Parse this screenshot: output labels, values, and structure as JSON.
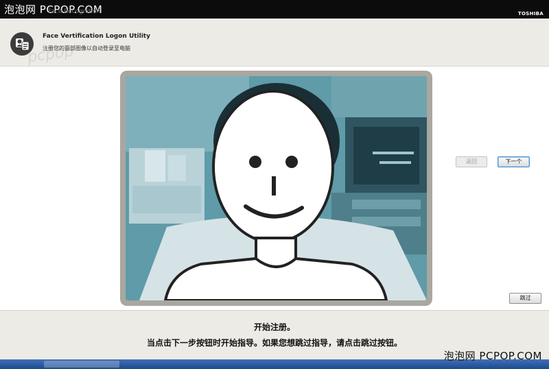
{
  "watermark": {
    "top": "泡泡网 PCPOP.COM",
    "bottom": "泡泡网 PCPOP.COM"
  },
  "window": {
    "title_faint": "Face Recognition",
    "brand": "TOSHIBA"
  },
  "header": {
    "title": "Face Vertification Logon Utility",
    "subtitle": "注册您的面部图像以自动登录至电脑"
  },
  "buttons": {
    "back": "返回",
    "next": "下一个",
    "skip": "跳过"
  },
  "instructions": {
    "line1": "开始注册。",
    "line2": "当点击下一步按钮时开始指导。如果您想跳过指导，请点击跳过按钮。"
  },
  "colors": {
    "camera_tint": "#5d9aa7",
    "frame": "#a9a7a0",
    "panel": "#ecebe6"
  },
  "icons": {
    "app": "user-face-icon"
  }
}
